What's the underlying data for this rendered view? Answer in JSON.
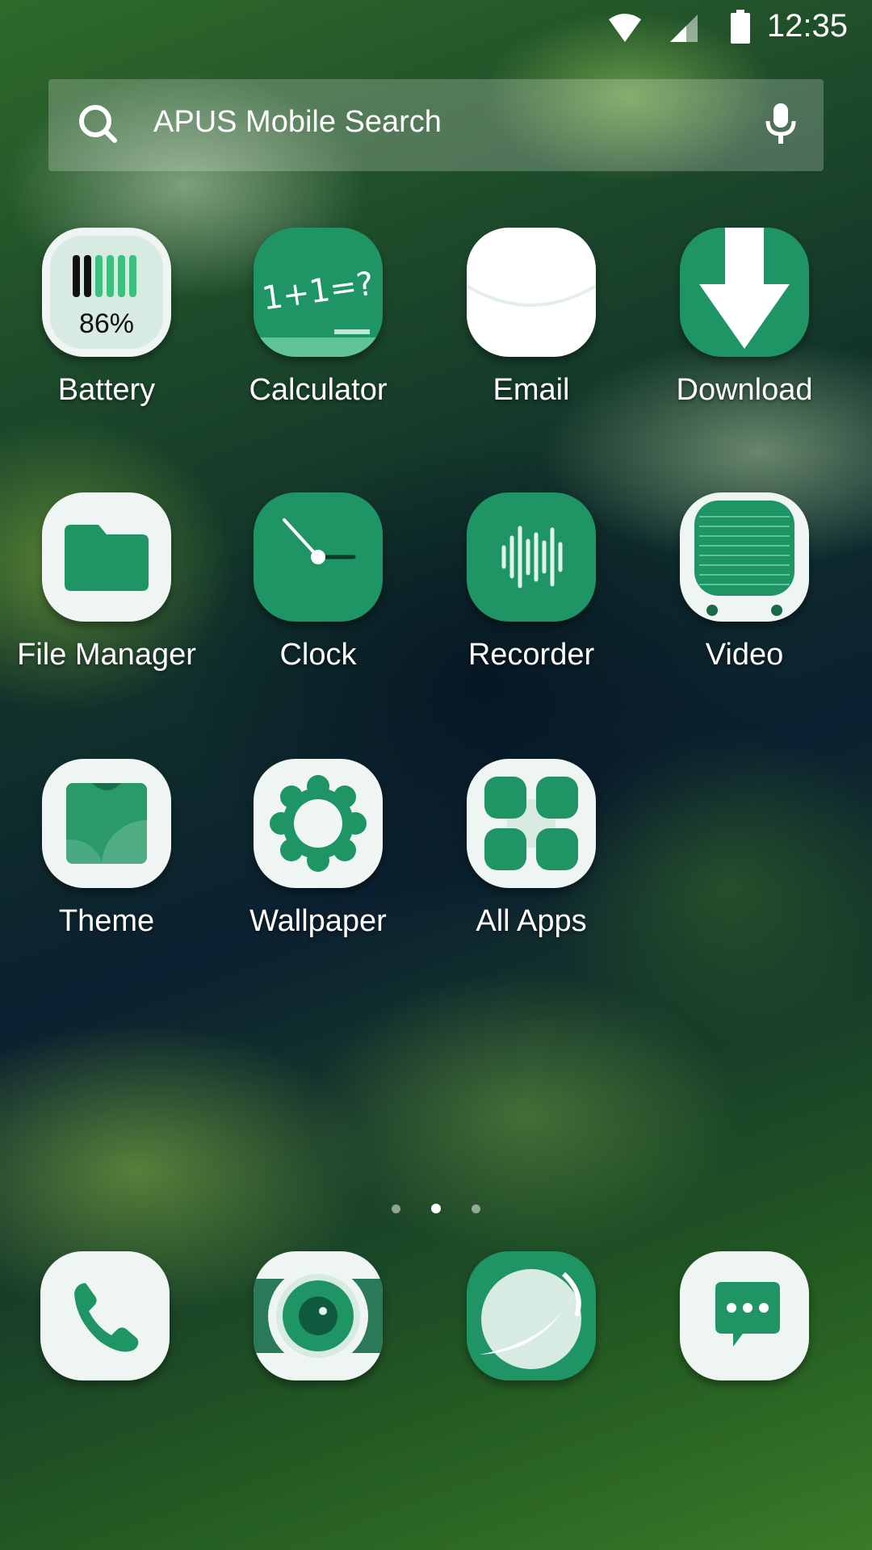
{
  "status": {
    "time": "12:35",
    "wifi": "wifi-icon",
    "signal": "signal-icon",
    "battery": "battery-icon"
  },
  "search": {
    "placeholder": "APUS Mobile Search",
    "search_icon": "search-icon",
    "mic_icon": "microphone-icon"
  },
  "apps": [
    {
      "label": "Battery",
      "icon": "battery-app-icon",
      "value": "86%"
    },
    {
      "label": "Calculator",
      "icon": "calculator-icon",
      "value": "1+1=?"
    },
    {
      "label": "Email",
      "icon": "email-icon"
    },
    {
      "label": "Download",
      "icon": "download-icon"
    },
    {
      "label": "File Manager",
      "icon": "folder-icon"
    },
    {
      "label": "Clock",
      "icon": "clock-icon"
    },
    {
      "label": "Recorder",
      "icon": "recorder-icon"
    },
    {
      "label": "Video",
      "icon": "video-icon"
    },
    {
      "label": "Theme",
      "icon": "theme-icon"
    },
    {
      "label": "Wallpaper",
      "icon": "wallpaper-icon"
    },
    {
      "label": "All Apps",
      "icon": "all-apps-icon"
    }
  ],
  "page_indicator": {
    "pages": 3,
    "active": 2
  },
  "dock": [
    {
      "icon": "phone-icon"
    },
    {
      "icon": "camera-icon"
    },
    {
      "icon": "browser-icon"
    },
    {
      "icon": "messages-icon"
    }
  ],
  "colors": {
    "accent": "#1f9465",
    "tile_light": "#eef5f2"
  }
}
